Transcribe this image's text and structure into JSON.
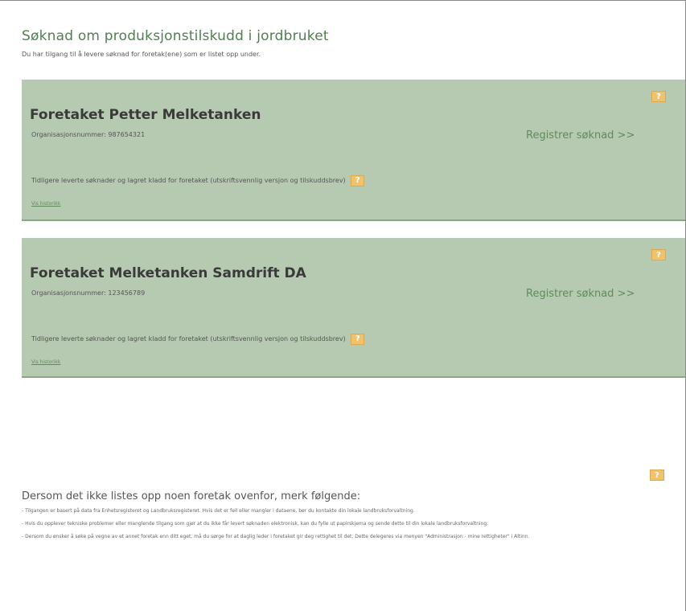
{
  "header": {
    "title": "Søknad om produksjonstilskudd i jordbruket",
    "subtitle": "Du har tilgang til å levere søknad for foretak(ene) som er listet opp under."
  },
  "help_icon_glyph": "?",
  "companies": [
    {
      "name": "Foretaket Petter Melketanken",
      "org_number": "Organisasjonsnummer: 987654321",
      "register_link": "Registrer søknad >>",
      "history_text": "Tidligere leverte søknader og lagret kladd for foretaket (utskriftsvennlig versjon og tilskuddsbrev)",
      "show_history": "Vis historikk"
    },
    {
      "name": "Foretaket Melketanken Samdrift DA",
      "org_number": "Organisasjonsnummer: 123456789",
      "register_link": "Registrer søknad >>",
      "history_text": "Tidligere leverte søknader og lagret kladd for foretaket (utskriftsvennlig versjon og tilskuddsbrev)",
      "show_history": "Vis historikk"
    }
  ],
  "footer": {
    "title": "Dersom det ikke listes opp noen foretak ovenfor, merk følgende:",
    "notes": [
      "- Tilgangen er basert på data fra Enhetsregisteret og Landbruksregisteret. Hvis det er feil eller mangler i dataene, bør du kontakte din lokale landbruksforvaltning.",
      "- Hvis du opplever tekniske problemer eller manglende tilgang som gjør at du ikke får levert søknaden elektronisk, kan du fylle ut papirskjema og sende dette til din lokale landbruksforvaltning.",
      "- Dersom du ønsker å søke på vegne av et annet foretak enn ditt eget, må du sørge for at daglig leder i foretaket gir deg rettighet til det. Dette delegeres via menyen \"Administrasjon - mine rettigheter\" i Altinn."
    ]
  },
  "colors": {
    "card_background": "#b6c9b1",
    "accent_green": "#5f8b5b",
    "help_icon": "#efc26e"
  }
}
